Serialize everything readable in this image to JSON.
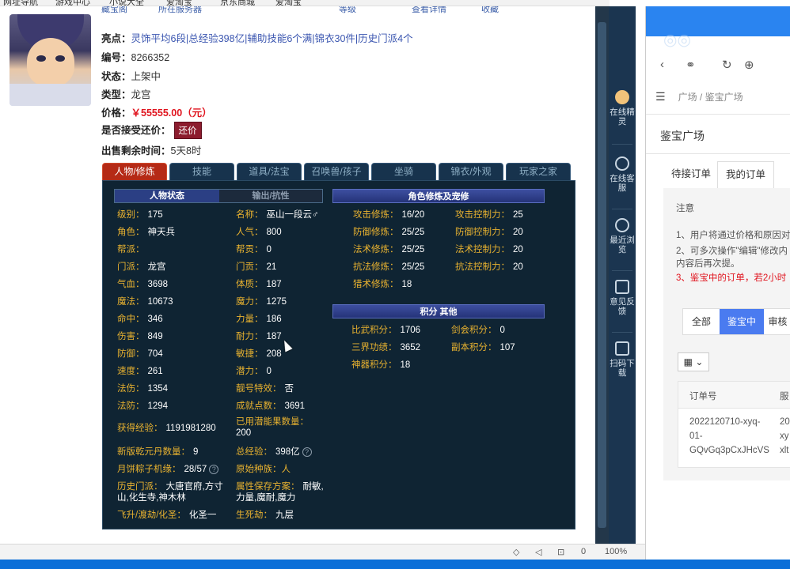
{
  "bookmarks": [
    "网址导航",
    "游戏中心",
    "小说大全",
    "爱淘宝",
    "京东商城",
    "爱淘宝"
  ],
  "topline": {
    "left": "藏宝阁",
    "middle": "所在服务器",
    "right": "等级",
    "fav": "收藏",
    "share": "查看详情"
  },
  "listing": {
    "highlights_label": "亮点：",
    "highlights_value": "灵饰平均6段|总经验398亿|辅助技能6个满|锦衣30件|历史门派4个",
    "id_label": "编号：",
    "id_value": "8266352",
    "status_label": "状态：",
    "status_value": "上架中",
    "type_label": "类型：",
    "type_value": "龙宫",
    "price_label": "价格：",
    "price_value": "￥55555.00（元）",
    "bargain_label": "是否接受还价：",
    "bargain_button": "还价",
    "time_label": "出售剩余时间：",
    "time_value": "5天8时"
  },
  "tabs": [
    "人物/修炼",
    "技能",
    "道具/法宝",
    "召唤兽/孩子",
    "坐骑",
    "锦衣/外观",
    "玩家之家"
  ],
  "subtabs": [
    "人物状态",
    "输出/抗性"
  ],
  "sections": {
    "cultivation": "角色修炼及宠修",
    "points": "积分  其他"
  },
  "stats_left": [
    {
      "label": "级别：",
      "value": "175"
    },
    {
      "label": "角色：",
      "value": "神天兵"
    },
    {
      "label": "帮派：",
      "value": ""
    },
    {
      "label": "门派：",
      "value": "龙宫"
    },
    {
      "label": "气血：",
      "value": "3698"
    },
    {
      "label": "魔法：",
      "value": "10673"
    },
    {
      "label": "命中：",
      "value": "346"
    },
    {
      "label": "伤害：",
      "value": "849"
    },
    {
      "label": "防御：",
      "value": "704"
    },
    {
      "label": "速度：",
      "value": "261"
    },
    {
      "label": "法伤：",
      "value": "1354"
    },
    {
      "label": "法防：",
      "value": "1294"
    }
  ],
  "stats_right": [
    {
      "label": "名称：",
      "value": "巫山一段云♂"
    },
    {
      "label": "人气：",
      "value": "800"
    },
    {
      "label": "帮贡：",
      "value": "0"
    },
    {
      "label": "门贡：",
      "value": "21"
    },
    {
      "label": "体质：",
      "value": "187"
    },
    {
      "label": "魔力：",
      "value": "1275"
    },
    {
      "label": "力量：",
      "value": "186"
    },
    {
      "label": "耐力：",
      "value": "187"
    },
    {
      "label": "敏捷：",
      "value": "208"
    },
    {
      "label": "潜力：",
      "value": "0"
    },
    {
      "label": "靓号特效：",
      "value": "否"
    },
    {
      "label": "成就点数：",
      "value": "3691"
    }
  ],
  "extra": {
    "exp_label": "获得经验：",
    "exp_value": "1191981280",
    "potion_label": "已用潜能果数量：",
    "potion_value": "200",
    "qiankun_label": "新版乾元丹数量：",
    "qiankun_value": "9",
    "total_exp_label": "总经验：",
    "total_exp_value": "398亿",
    "zongzi_label": "月饼粽子机缘：",
    "zongzi_value": "28/57",
    "race_label": "原始种族：",
    "race_value": "人",
    "history_label": "历史门派：",
    "history_value": "大唐官府,方寸山,化生寺,神木林",
    "plan_label": "属性保存方案：",
    "plan_value": "耐敏,力量,魔耐,魔力",
    "fly_label": "飞升/渡劫/化圣：",
    "fly_value": "化圣一",
    "life_label": "生死劫：",
    "life_value": "九层"
  },
  "cultivation": [
    {
      "label": "攻击修炼：",
      "value": "16/20",
      "label2": "攻击控制力：",
      "value2": "25"
    },
    {
      "label": "防御修炼：",
      "value": "25/25",
      "label2": "防御控制力：",
      "value2": "20"
    },
    {
      "label": "法术修炼：",
      "value": "25/25",
      "label2": "法术控制力：",
      "value2": "20"
    },
    {
      "label": "抗法修炼：",
      "value": "25/25",
      "label2": "抗法控制力：",
      "value2": "20"
    },
    {
      "label": "猎术修炼：",
      "value": "18",
      "label2": "",
      "value2": ""
    }
  ],
  "points": [
    {
      "label": "比武积分：",
      "value": "1706",
      "label2": "剑会积分：",
      "value2": "0"
    },
    {
      "label": "三界功绩：",
      "value": "3652",
      "label2": "副本积分：",
      "value2": "107"
    },
    {
      "label": "神器积分：",
      "value": "18",
      "label2": "",
      "value2": ""
    }
  ],
  "dock": [
    {
      "label": "在线精灵",
      "icon": "sprite-face-icon"
    },
    {
      "label": "在线客服",
      "icon": "headset-icon"
    },
    {
      "label": "最近浏览",
      "icon": "clock-icon"
    },
    {
      "label": "意见反馈",
      "icon": "edit-icon"
    },
    {
      "label": "扫码下载",
      "icon": "scan-icon"
    }
  ],
  "statusbar": {
    "zoom": "100%",
    "count": "0"
  },
  "right_panel": {
    "breadcrumb_root": "广场",
    "breadcrumb_sep": "/",
    "breadcrumb_leaf": "鉴宝广场",
    "title": "鉴宝广场",
    "tab_pending": "待接订单",
    "tab_mine": "我的订单",
    "notice_title": "注意",
    "notice_1": "1、用户将通过价格和原因对",
    "notice_2": "2、可多次操作\"编辑\"修改内",
    "notice_2b": "内容后再次提。",
    "notice_3": "3、鉴宝中的订单，若2小时",
    "filter_all": "全部",
    "filter_active": "鉴宝中",
    "filter_review": "审核",
    "col_order": "订单号",
    "col_next": "服",
    "order_id_1": "2022120710-xyq-",
    "order_id_2": "01-",
    "order_id_3": "GQvGq3pCxJHcVS",
    "order_side_1": "20",
    "order_side_2": "xy",
    "order_side_3": "xlt"
  }
}
